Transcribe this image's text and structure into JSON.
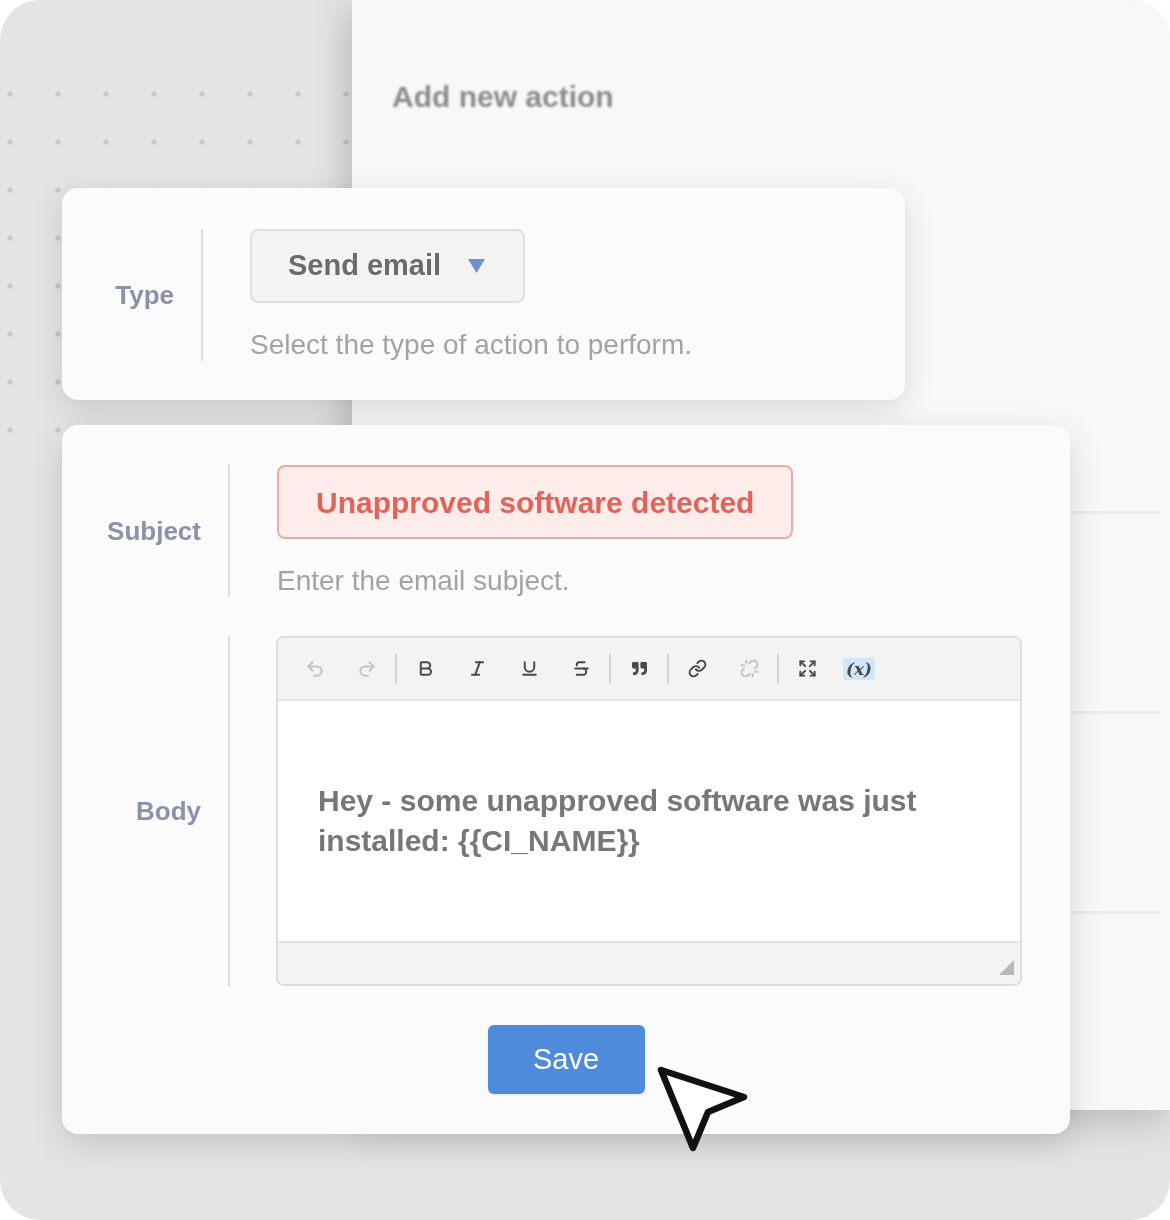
{
  "background_panel": {
    "title": "Add new action"
  },
  "type_card": {
    "label": "Type",
    "select": {
      "value": "Send email"
    },
    "help": "Select the type of action to perform."
  },
  "email_card": {
    "subject": {
      "label": "Subject",
      "value": "Unapproved software detected",
      "invalid": true,
      "help": "Enter the email subject."
    },
    "body": {
      "label": "Body",
      "toolbar": [
        [
          {
            "kind": "icon",
            "disabled": true,
            "active": false
          },
          {
            "kind": "icon",
            "disabled": true,
            "active": false
          }
        ],
        [
          {
            "kind": "icon",
            "disabled": false,
            "active": false
          },
          {
            "kind": "icon",
            "disabled": false,
            "active": false
          },
          {
            "kind": "icon",
            "disabled": false,
            "active": false
          },
          {
            "kind": "icon",
            "disabled": false,
            "active": false
          }
        ],
        [
          {
            "kind": "icon",
            "disabled": false,
            "active": false
          }
        ],
        [
          {
            "kind": "icon",
            "disabled": false,
            "active": false
          },
          {
            "kind": "icon",
            "disabled": true,
            "active": false
          }
        ],
        [
          {
            "kind": "icon",
            "disabled": false,
            "active": false
          },
          {
            "kind": "text",
            "label": "(x)",
            "disabled": false,
            "active": true
          }
        ]
      ],
      "value": "Hey - some unapproved software was just installed: {{CI_NAME}}"
    },
    "save_button": {
      "label": "Save"
    }
  }
}
